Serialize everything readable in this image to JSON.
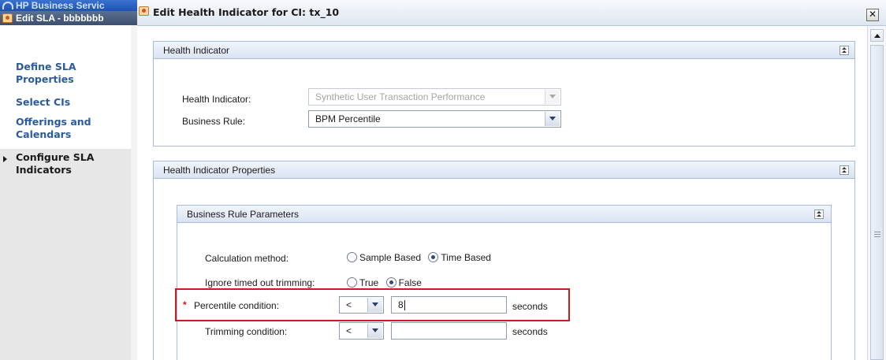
{
  "background_window": {
    "title": "HP Business Servic",
    "subtitle": "Edit SLA - bbbbbbb",
    "steps": [
      {
        "label": "Define SLA Properties"
      },
      {
        "label": "Select CIs"
      },
      {
        "label": "Offerings and Calendars"
      },
      {
        "label": "Configure SLA Indicators",
        "active": true
      }
    ]
  },
  "dialog": {
    "title": "Edit Health Indicator for CI: tx_10",
    "close_glyph": "✕"
  },
  "health_indicator_panel": {
    "title": "Health Indicator",
    "health_indicator_label": "Health Indicator:",
    "health_indicator_value": "Synthetic User Transaction Performance",
    "health_indicator_disabled": true,
    "business_rule_label": "Business Rule:",
    "business_rule_value": "BPM Percentile"
  },
  "properties_panel": {
    "title": "Health Indicator Properties",
    "rule_params": {
      "title": "Business Rule Parameters",
      "calculation_method": {
        "label": "Calculation method:",
        "options": [
          {
            "label": "Sample Based",
            "checked": false
          },
          {
            "label": "Time Based",
            "checked": true
          }
        ]
      },
      "ignore_timed_out": {
        "label": "Ignore timed out trimming:",
        "options": [
          {
            "label": "True",
            "checked": false
          },
          {
            "label": "False",
            "checked": true
          }
        ]
      },
      "percentile_condition": {
        "required_marker": "*",
        "label": "Percentile condition:",
        "operator": "<",
        "value": "8",
        "unit": "seconds",
        "highlighted": true
      },
      "trimming_condition": {
        "label": "Trimming condition:",
        "operator": "<",
        "value": "",
        "unit": "seconds"
      }
    }
  },
  "colors": {
    "link": "#2a5b9e",
    "highlight": "#c21f1f",
    "required": "#d11a1a",
    "panel_border": "#a9bbd6"
  }
}
